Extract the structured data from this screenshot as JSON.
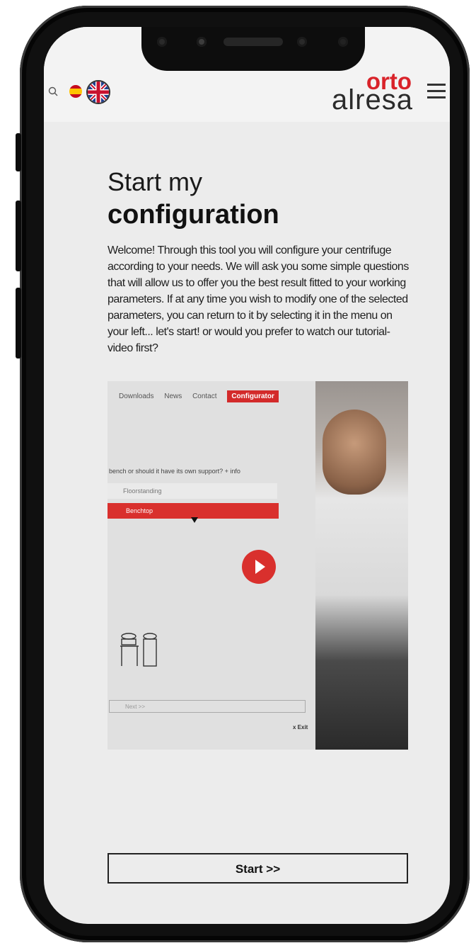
{
  "header": {
    "logo_top": "orto",
    "logo_bottom": "alresa"
  },
  "page": {
    "title_line1": "Start my",
    "title_line2": "configuration",
    "intro": "Welcome! Through this tool you will configure your centrifuge according to your needs. We will ask you some simple questions that will allow us to offer you the best result fitted to your working parameters. If at any time you wish to modify one of the selected parameters, you can return to it by selecting it in the menu on your left... let's start! or would you prefer to watch our tutorial-video first?"
  },
  "video": {
    "nav": [
      "Downloads",
      "News",
      "Contact",
      "Configurator"
    ],
    "question": "bench or should it have its own support? + info",
    "option1": "Floorstanding",
    "option2": "Benchtop",
    "next": "Next >>",
    "exit": "x Exit"
  },
  "actions": {
    "start_label": "Start >>"
  },
  "colors": {
    "brand_red": "#d9232a",
    "text_dark": "#1e1e1e",
    "background": "#ececec"
  },
  "icons": [
    "search-icon",
    "flag-spain-icon",
    "flag-uk-icon",
    "menu-icon",
    "play-icon"
  ]
}
